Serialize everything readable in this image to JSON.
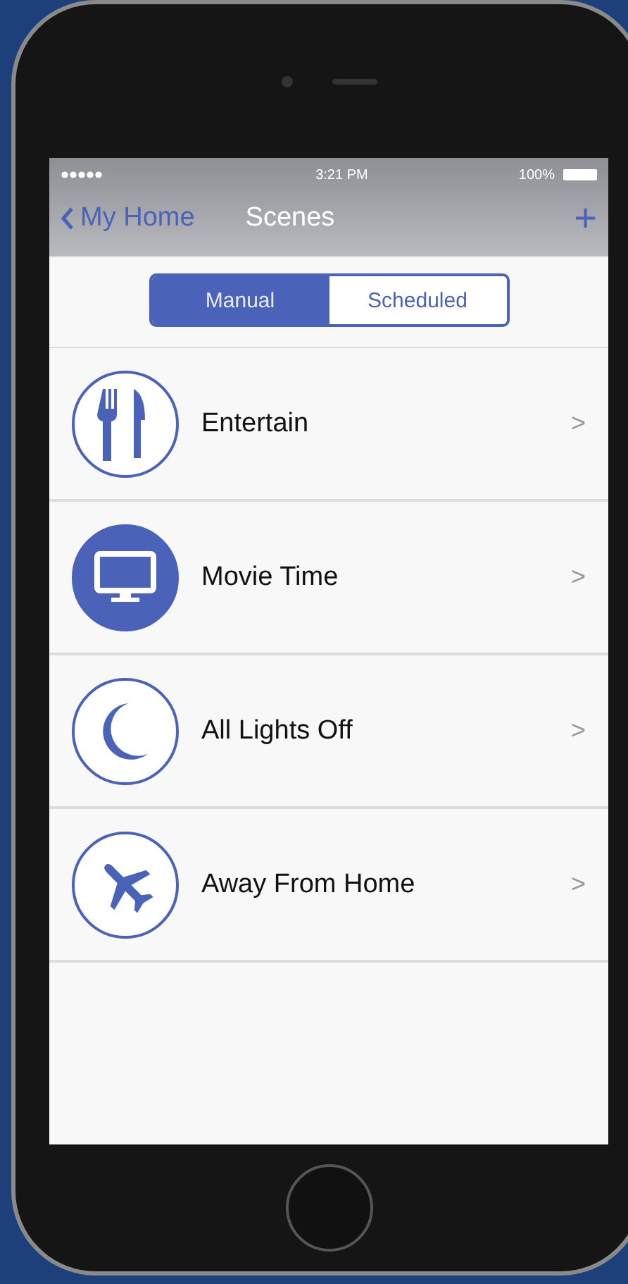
{
  "status_bar": {
    "time": "3:21 PM",
    "battery": "100%"
  },
  "nav": {
    "back": "My Home",
    "title": "Scenes",
    "add": "+"
  },
  "segments": [
    {
      "label": "Manual",
      "selected": true
    },
    {
      "label": "Scheduled",
      "selected": false
    }
  ],
  "scenes": [
    {
      "name": "Entertain",
      "kind": "dining",
      "active": false,
      "chevron": ">"
    },
    {
      "name": "Movie Time",
      "kind": "tv",
      "active": true,
      "chevron": ">"
    },
    {
      "name": "All Lights Off",
      "kind": "moon",
      "active": false,
      "chevron": ">"
    },
    {
      "name": "Away From Home",
      "kind": "plane",
      "active": false,
      "chevron": ">"
    }
  ]
}
